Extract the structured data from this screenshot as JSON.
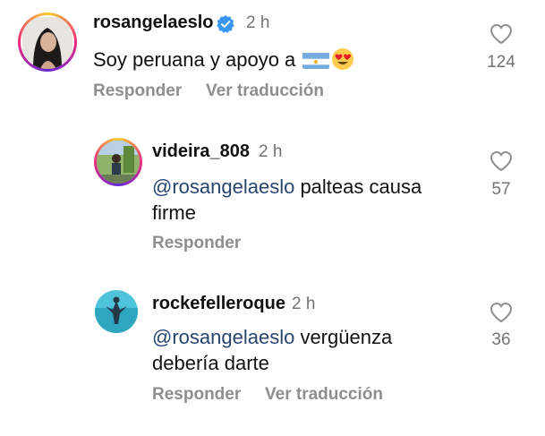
{
  "comments": [
    {
      "username": "rosangelaeslo",
      "verified": true,
      "time": "2 h",
      "text": "Soy peruana y apoyo a ",
      "emoji": [
        "argentina-flag",
        "heart-eyes-face"
      ],
      "likes": "124",
      "actions": {
        "reply": "Responder",
        "translate": "Ver traducción"
      }
    },
    {
      "username": "videira_808",
      "time": "2 h",
      "mention": "@rosangelaeslo",
      "text_line1": " palteas causa",
      "text_line2": "firme",
      "likes": "57",
      "actions": {
        "reply": "Responder"
      }
    },
    {
      "username": "rockefelleroque",
      "time": "2 h",
      "mention": "@rosangelaeslo",
      "text_line1": " vergüenza",
      "text_line2": "debería darte",
      "likes": "36",
      "actions": {
        "reply": "Responder",
        "translate": "Ver traducción"
      }
    }
  ],
  "colors": {
    "mention": "#27466f",
    "secondary_text": "#737373",
    "action_text": "#8e8e8e",
    "verified_badge": "#3897f0"
  }
}
